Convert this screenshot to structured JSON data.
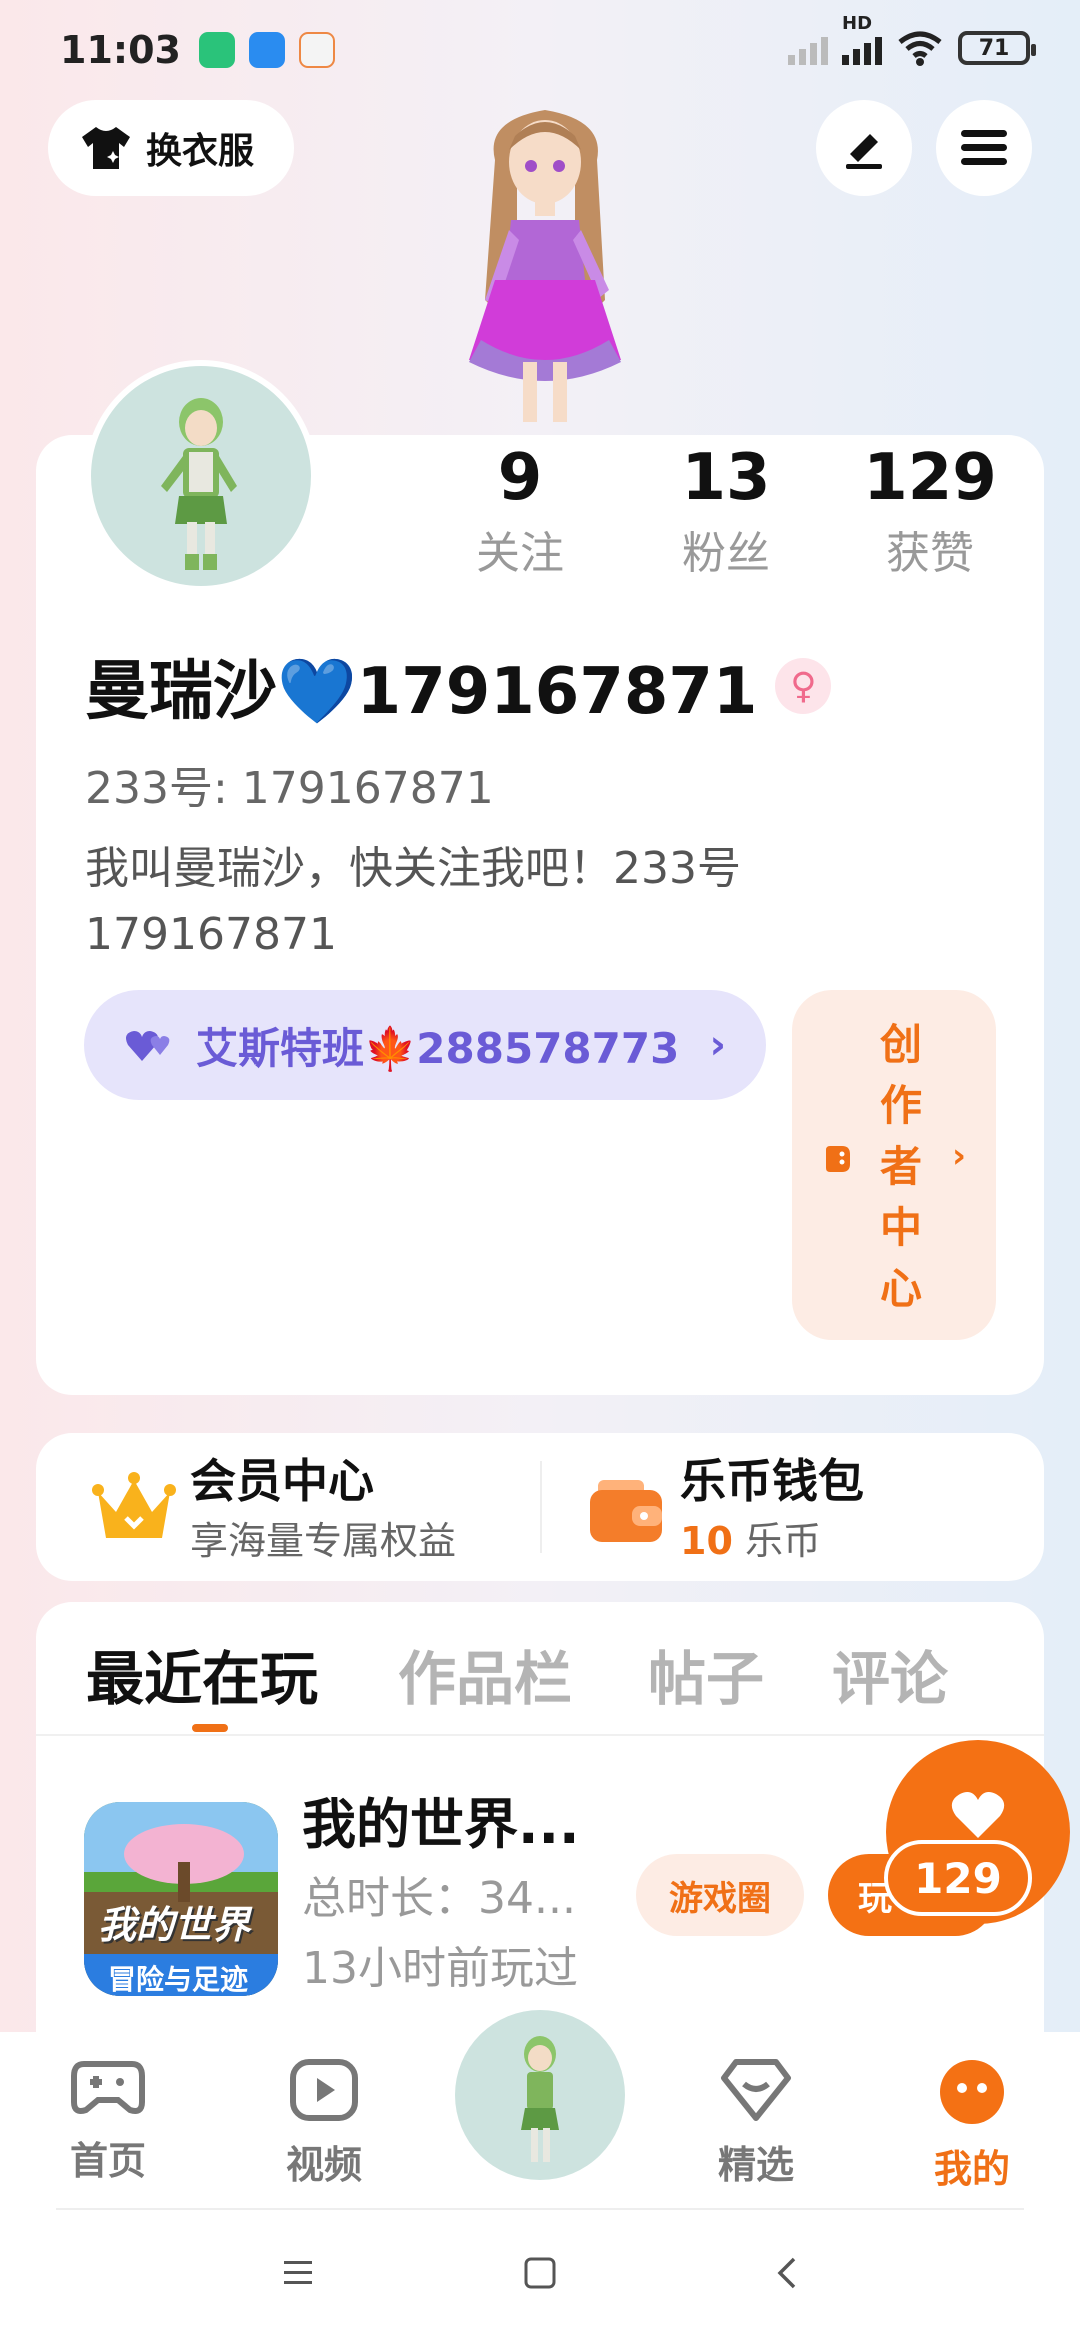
{
  "status_bar": {
    "time": "11:03",
    "network_label": "HD",
    "battery": "71"
  },
  "header": {
    "outfit_label": "换衣服"
  },
  "profile": {
    "stats": [
      {
        "value": "9",
        "label": "关注"
      },
      {
        "value": "13",
        "label": "粉丝"
      },
      {
        "value": "129",
        "label": "获赞"
      }
    ],
    "username": "曼瑞沙💙179167871",
    "uid_line": "233号: 179167871",
    "bio": "我叫曼瑞沙，快关注我吧！233号179167871",
    "group_label": "艾斯特班🍁288578773",
    "group_chevron": "›",
    "creator_label": "创作者中心"
  },
  "member": {
    "vip_title": "会员中心",
    "vip_sub": "享海量专属权益",
    "wallet_title": "乐币钱包",
    "wallet_amount": "10",
    "wallet_unit": "乐币"
  },
  "tabs": [
    {
      "label": "最近在玩",
      "active": true
    },
    {
      "label": "作品栏",
      "active": false
    },
    {
      "label": "帖子",
      "active": false
    },
    {
      "label": "评论",
      "active": false
    }
  ],
  "recent_game": {
    "title": "我的世界...",
    "total_time": "总时长：34...",
    "last_played": "13小时前玩过",
    "icon_text_top": "我的世界",
    "icon_text_bottom": "冒险与足迹",
    "circle_button": "游戏圈",
    "play_button": "玩"
  },
  "like_float": {
    "count": "129"
  },
  "bottom_nav": [
    {
      "label": "首页",
      "icon": "gamepad-icon",
      "active": false
    },
    {
      "label": "视频",
      "icon": "video-play-icon",
      "active": false
    },
    {
      "label": "",
      "icon": "avatar",
      "active": false
    },
    {
      "label": "精选",
      "icon": "heart-shield-icon",
      "active": false
    },
    {
      "label": "我的",
      "icon": "face-dots-icon",
      "active": true
    }
  ],
  "colors": {
    "accent": "#f07016",
    "group_text": "#6a5bd6",
    "group_bg": "#e6e4fb"
  }
}
